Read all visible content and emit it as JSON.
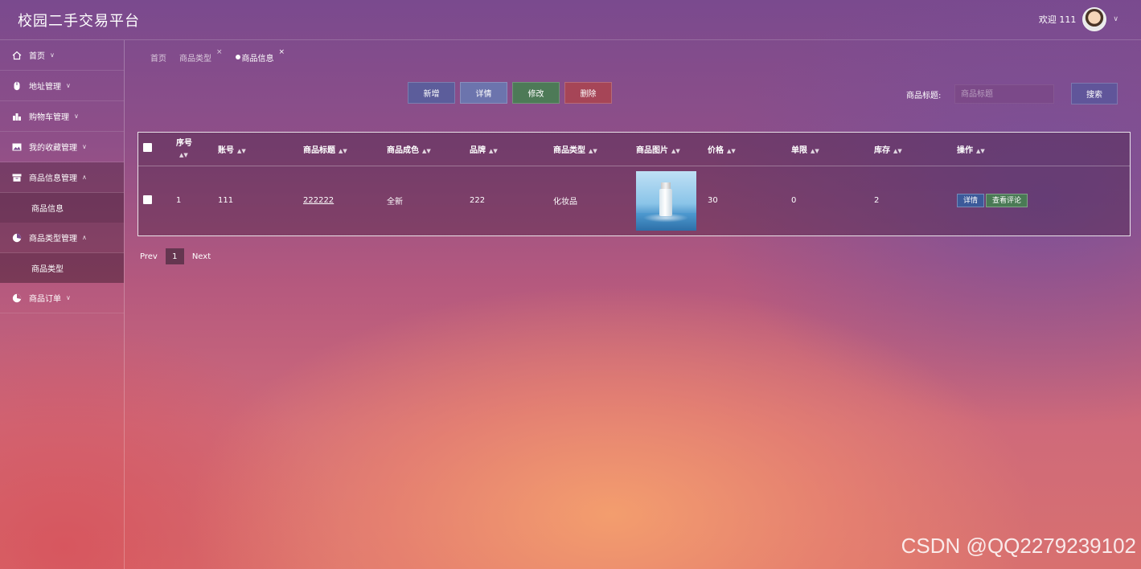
{
  "header": {
    "app_title": "校园二手交易平台",
    "welcome_text": "欢迎 111"
  },
  "sidebar": {
    "items": [
      {
        "label": "首页",
        "icon": "home-icon"
      },
      {
        "label": "地址管理",
        "icon": "mouse-icon"
      },
      {
        "label": "购物车管理",
        "icon": "chart-icon"
      },
      {
        "label": "我的收藏管理",
        "icon": "picture-icon"
      },
      {
        "label": "商品信息管理",
        "icon": "box-icon",
        "sub": "商品信息"
      },
      {
        "label": "商品类型管理",
        "icon": "pie-icon",
        "sub": "商品类型"
      },
      {
        "label": "商品订单",
        "icon": "pie-icon"
      }
    ]
  },
  "tabs": {
    "home": "首页",
    "category": "商品类型",
    "info": "商品信息",
    "close": "×"
  },
  "toolbar": {
    "add": "新增",
    "detail": "详情",
    "edit": "修改",
    "delete": "删除",
    "search_label": "商品标题:",
    "search_placeholder": "商品标题",
    "search_button": "搜索"
  },
  "table": {
    "columns": [
      "序号",
      "账号",
      "商品标题",
      "商品成色",
      "品牌",
      "商品类型",
      "商品图片",
      "价格",
      "单限",
      "库存",
      "操作"
    ],
    "rows": [
      {
        "index": "1",
        "account": "111",
        "title": "222222",
        "condition": "全新",
        "brand": "222",
        "type": "化妆品",
        "price": "30",
        "limit": "0",
        "stock": "2",
        "op_detail": "详情",
        "op_review": "查看评论"
      }
    ]
  },
  "pager": {
    "prev": "Prev",
    "page": "1",
    "next": "Next"
  },
  "watermark": "CSDN @QQ2279239102"
}
